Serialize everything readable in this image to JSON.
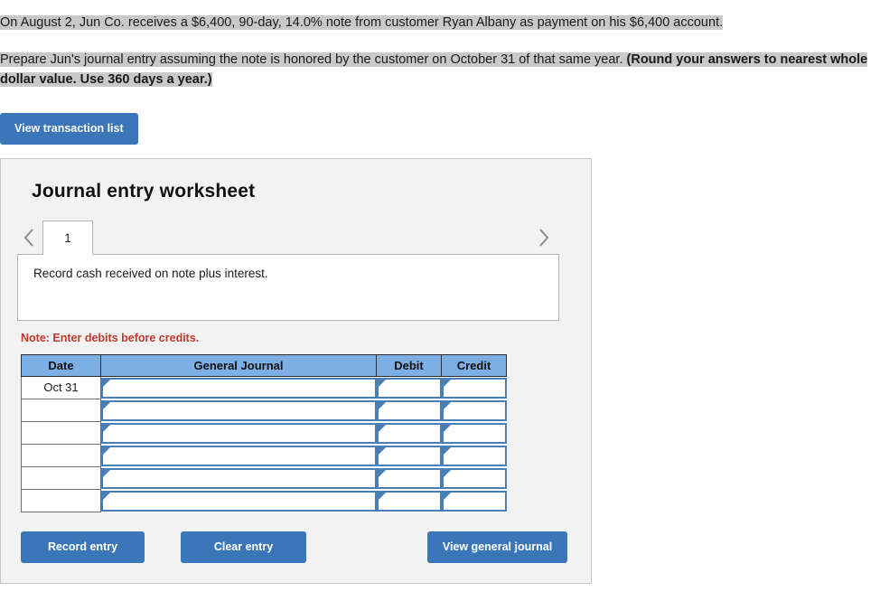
{
  "problem": {
    "paragraph_1": "On August 2, Jun Co. receives a $6,400, 90-day, 14.0% note from customer Ryan Albany as payment on his $6,400 account.",
    "paragraph_2_normal": "Prepare Jun's journal entry assuming the note is honored by the customer on October 31 of that same year. ",
    "paragraph_2_bold": "(Round your answers to nearest whole dollar value. Use 360 days a year.)"
  },
  "toolbar": {
    "view_transaction_list_label": "View transaction list"
  },
  "worksheet": {
    "title": "Journal entry worksheet",
    "prev_icon": "chevron-left-icon",
    "next_icon": "chevron-right-icon",
    "tabs": [
      {
        "label": "1",
        "selected": true
      }
    ],
    "instruction": "Record cash received on note plus interest.",
    "note": "Note: Enter debits before credits."
  },
  "journal_table": {
    "columns": [
      "Date",
      "General Journal",
      "Debit",
      "Credit"
    ],
    "rows": [
      {
        "date": "Oct 31",
        "general_journal": "",
        "debit": "",
        "credit": ""
      },
      {
        "date": "",
        "general_journal": "",
        "debit": "",
        "credit": ""
      },
      {
        "date": "",
        "general_journal": "",
        "debit": "",
        "credit": ""
      },
      {
        "date": "",
        "general_journal": "",
        "debit": "",
        "credit": ""
      },
      {
        "date": "",
        "general_journal": "",
        "debit": "",
        "credit": ""
      },
      {
        "date": "",
        "general_journal": "",
        "debit": "",
        "credit": ""
      }
    ]
  },
  "footer": {
    "record_entry_label": "Record entry",
    "clear_entry_label": "Clear entry",
    "view_general_journal_label": "View general journal"
  },
  "colors": {
    "button_blue": "#3b76b8",
    "table_header_blue": "#7daee4",
    "cell_border_blue": "#4a7fb5",
    "note_red": "#c0392b",
    "panel_gray": "#f2f2f2",
    "highlight_gray": "#c9c9c9"
  }
}
